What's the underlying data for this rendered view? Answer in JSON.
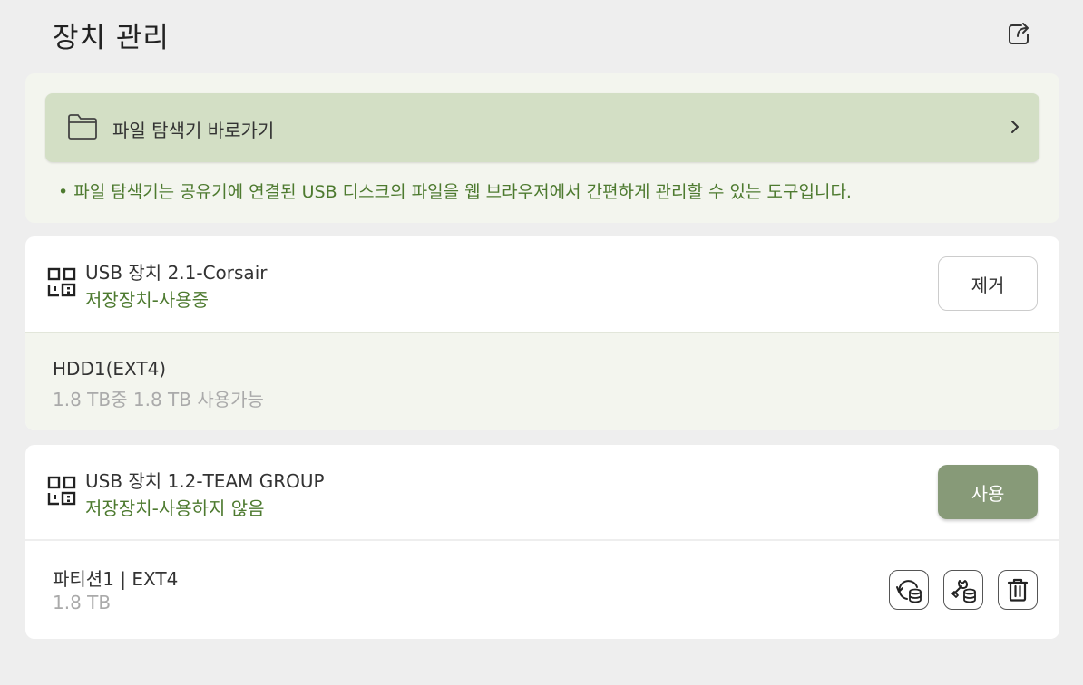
{
  "header": {
    "title": "장치 관리",
    "share_icon": "share-export-icon"
  },
  "explorer": {
    "link_label": "파일 탐색기 바로가기",
    "note": "• 파일 탐색기는 공유기에 연결된 USB 디스크의 파일을 웹 브라우저에서 간편하게 관리할 수 있는 도구입니다."
  },
  "devices": [
    {
      "name": "USB 장치 2.1-Corsair",
      "status": "저장장치-사용중",
      "action_label": "제거",
      "partition": {
        "name": "HDD1(EXT4)",
        "size": "1.8 TB중 1.8 TB 사용가능"
      }
    },
    {
      "name": "USB 장치 1.2-TEAM GROUP",
      "status": "저장장치-사용하지 않음",
      "action_label": "사용",
      "partition": {
        "name": "파티션1 | EXT4",
        "size": "1.8 TB",
        "actions": [
          "disk-refresh-icon",
          "disk-repair-icon",
          "trash-icon"
        ]
      }
    }
  ],
  "colors": {
    "accent_green": "#4d7a2f",
    "button_green": "#879a78",
    "link_bg": "#d3dfc5",
    "card_tint": "#f3f5ee"
  }
}
